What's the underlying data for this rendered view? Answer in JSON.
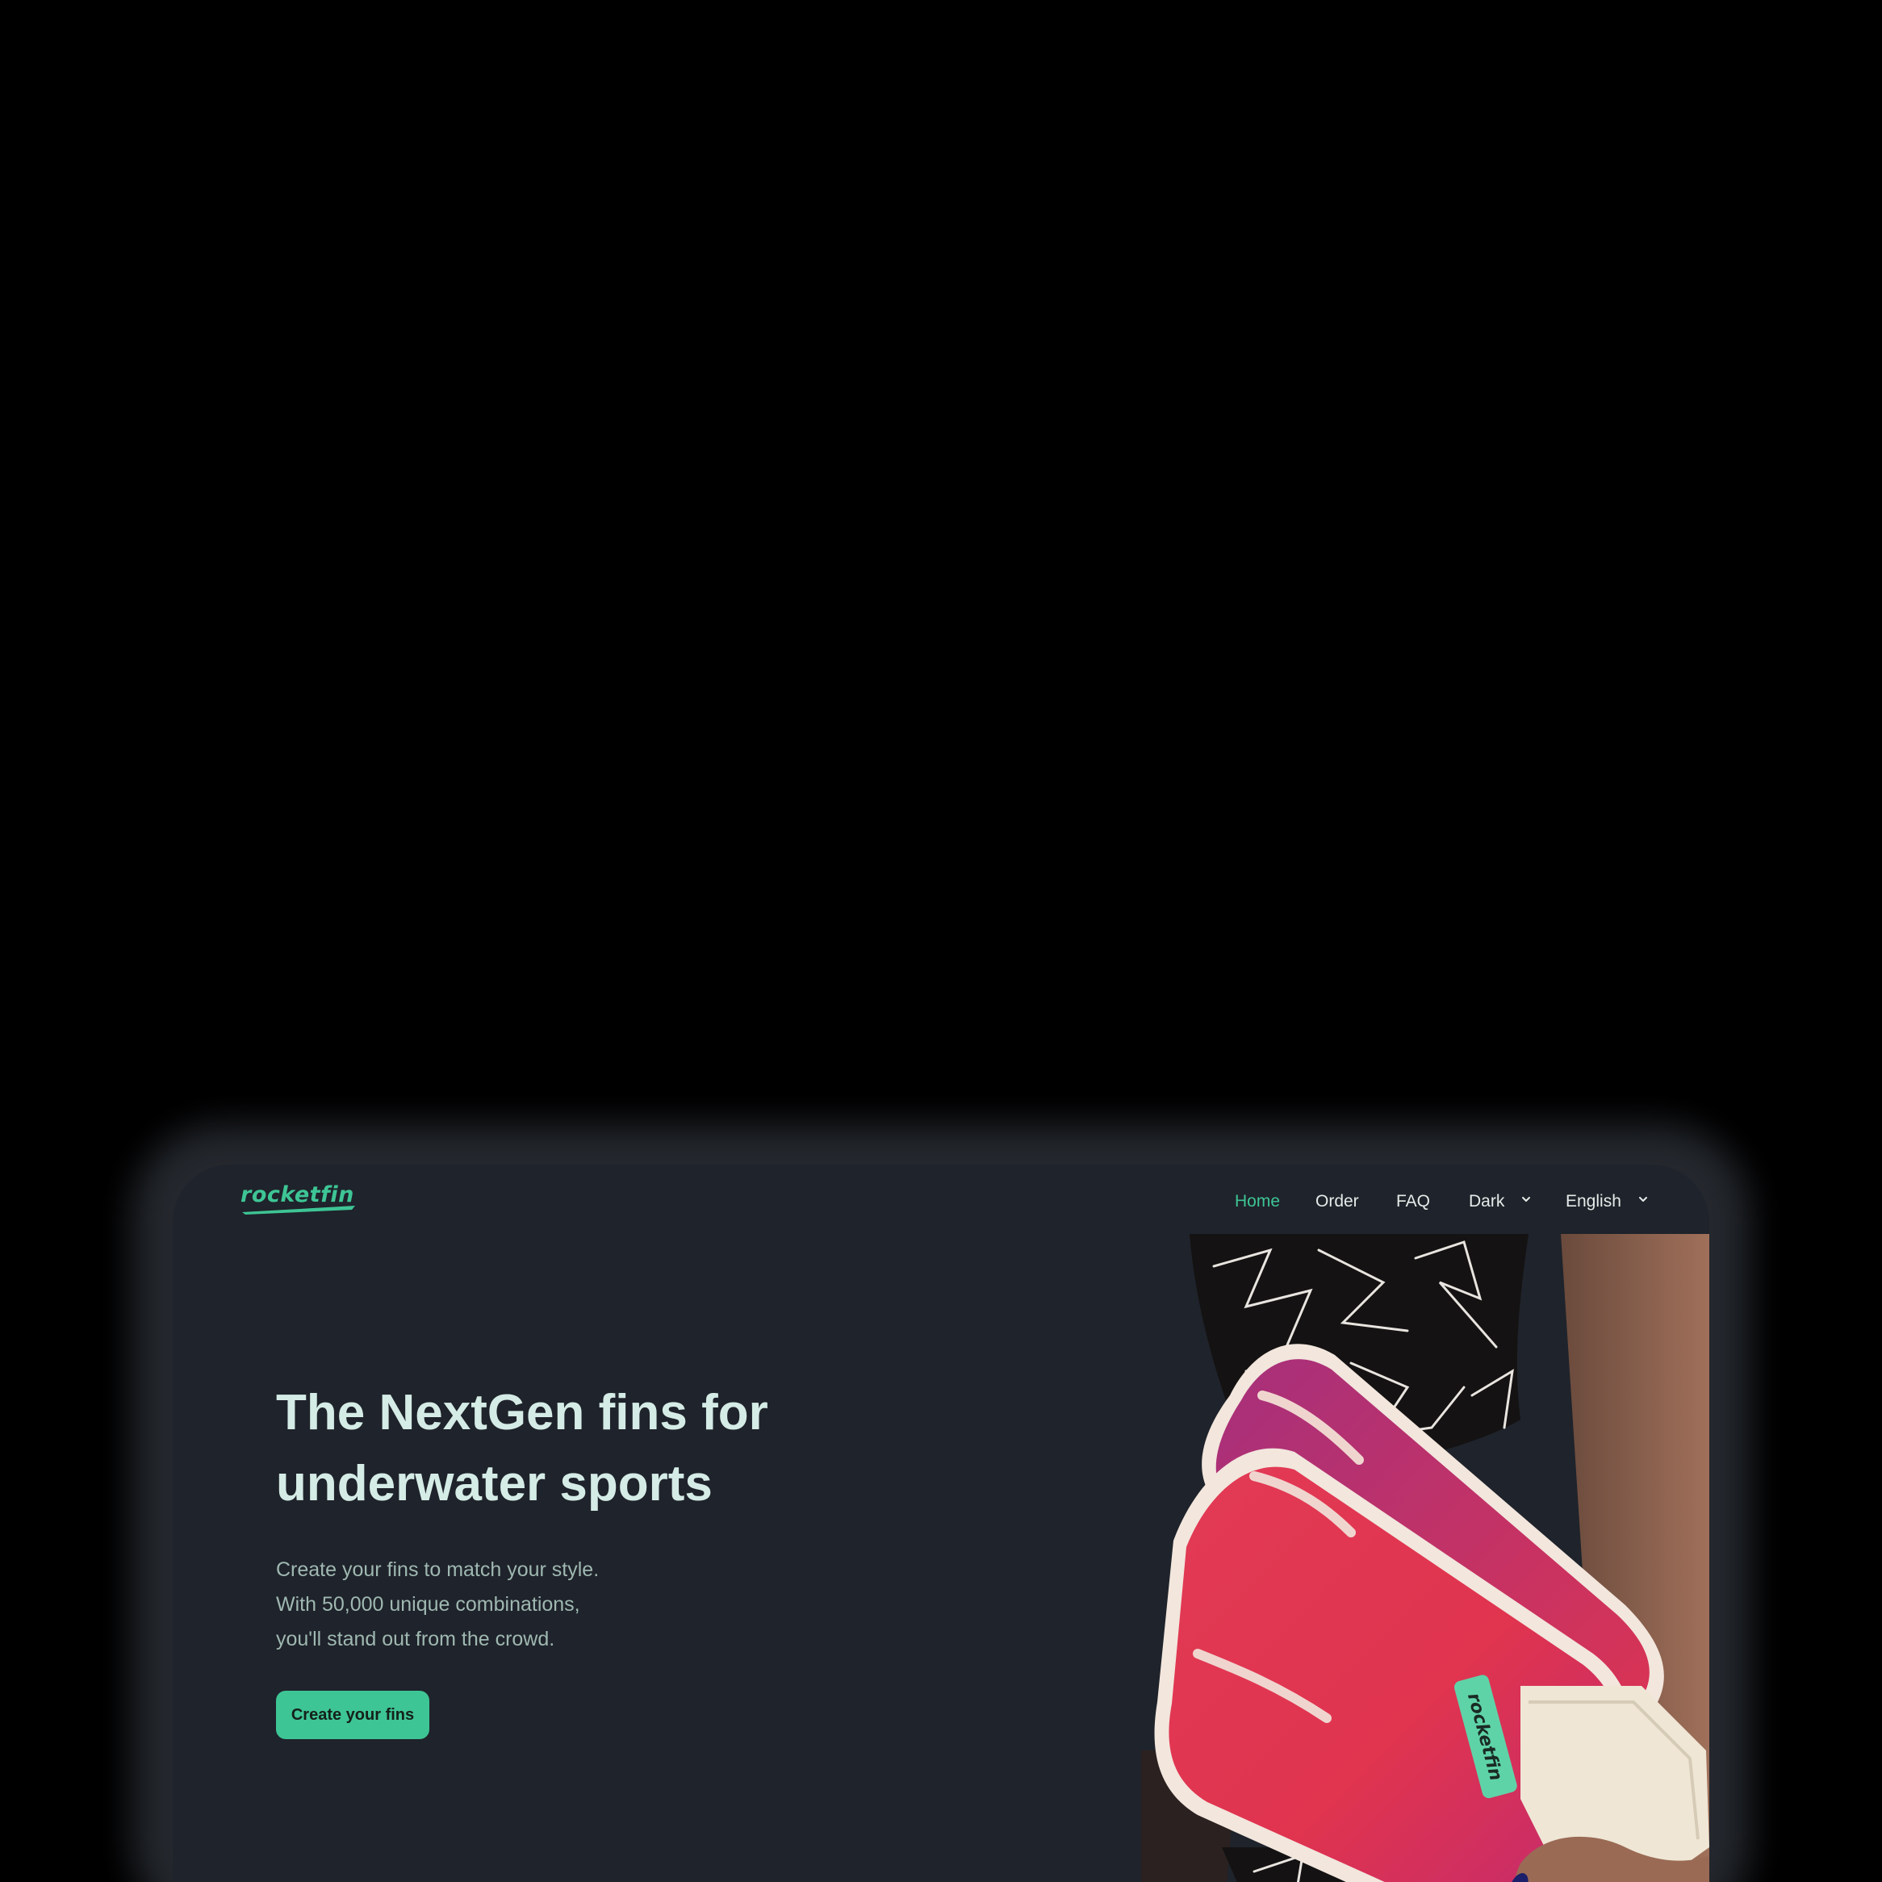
{
  "brand": {
    "name": "rocketfin",
    "accent_color": "#3ec595",
    "background_color": "#1f232b"
  },
  "nav": {
    "items": [
      {
        "label": "Home",
        "active": true
      },
      {
        "label": "Order",
        "active": false
      },
      {
        "label": "FAQ",
        "active": false
      }
    ],
    "theme_select": {
      "selected": "Dark",
      "icon": "chevron-down-icon"
    },
    "language_select": {
      "selected": "English",
      "icon": "chevron-down-icon"
    }
  },
  "hero": {
    "title_line1": "The NextGen fins for",
    "title_line2": "underwater sports",
    "subtitle_line1": "Create your fins to match your style.",
    "subtitle_line2": "With 50,000 unique combinations,",
    "subtitle_line3": "you'll stand out from the crowd.",
    "cta_label": "Create your fins"
  },
  "product_image": {
    "fin_brand": "rocketfin",
    "fin_color": "#e0344f",
    "fin_gradient_color": "#c5307a",
    "fin_rim_color": "#f2e6dd",
    "foot_pocket_color": "#efe6d5",
    "label_color": "#5fd3a8"
  }
}
